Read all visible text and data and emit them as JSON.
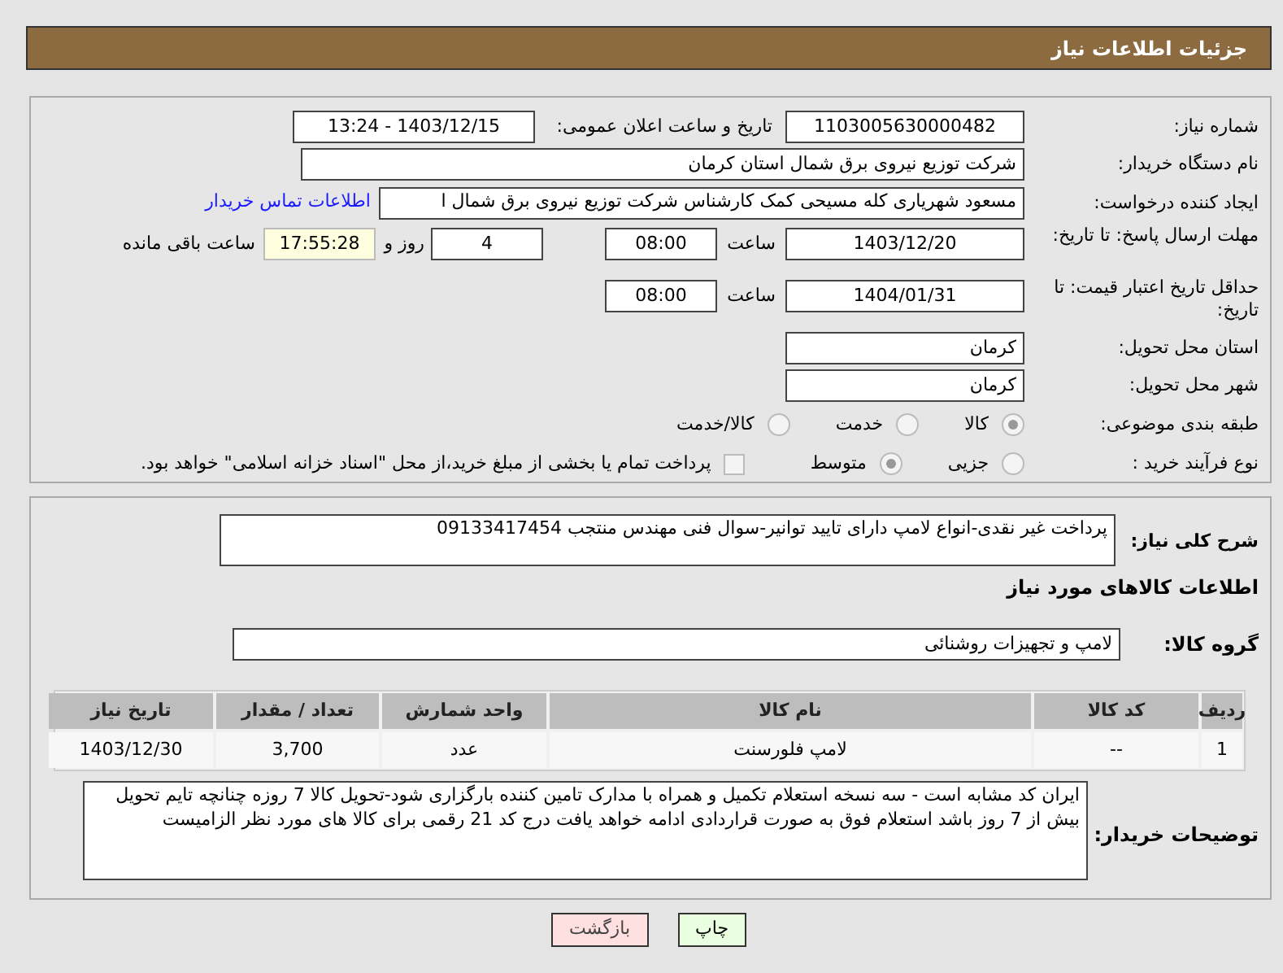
{
  "page_title": "جزئیات اطلاعات نیاز",
  "need_number": {
    "label": "شماره نیاز:",
    "value": "1103005630000482"
  },
  "announce": {
    "label": "تاریخ و ساعت اعلان عمومی:",
    "value": "1403/12/15 - 13:24"
  },
  "buyer_org": {
    "label": "نام دستگاه خریدار:",
    "value": "شرکت توزیع نیروی برق شمال استان کرمان"
  },
  "requester": {
    "label": "ایجاد کننده درخواست:",
    "value": "مسعود شهرياری کله مسیحی کمک کارشناس شرکت توزیع نیروی برق شمال ا",
    "link": "اطلاعات تماس خریدار"
  },
  "response_deadline": {
    "label": "مهلت ارسال پاسخ: تا تاریخ:",
    "date": "1403/12/20",
    "time_label": "ساعت",
    "time": "08:00",
    "days": "4",
    "days_label": "روز و",
    "remaining": "17:55:28",
    "remaining_label": "ساعت باقی مانده"
  },
  "price_validity": {
    "label": "حداقل تاریخ اعتبار قیمت: تا تاریخ:",
    "date": "1404/01/31",
    "time_label": "ساعت",
    "time": "08:00"
  },
  "province": {
    "label": "استان محل تحویل:",
    "value": "کرمان"
  },
  "city": {
    "label": "شهر محل تحویل:",
    "value": "کرمان"
  },
  "category": {
    "label": "طبقه بندی موضوعی:",
    "options": [
      {
        "label": "کالا",
        "selected": true
      },
      {
        "label": "خدمت",
        "selected": false
      },
      {
        "label": "کالا/خدمت",
        "selected": false
      }
    ]
  },
  "process": {
    "label": "نوع فرآیند خرید :",
    "options": [
      {
        "label": "جزیی",
        "selected": false
      },
      {
        "label": "متوسط",
        "selected": true
      }
    ],
    "payment": {
      "label": "پرداخت تمام یا بخشی از مبلغ خرید،از محل \"اسناد خزانه اسلامی\" خواهد بود.",
      "checked": false
    }
  },
  "description": {
    "label": "شرح کلی نیاز:",
    "value": "پرداخت غیر نقدی-انواع لامپ دارای تایید توانیر-سوال فنی مهندس منتجب 09133417454"
  },
  "goods_title": "اطلاعات کالاهای مورد نیاز",
  "goods_group": {
    "label": "گروه کالا:",
    "value": "لامپ و تجهیزات روشنائی"
  },
  "table": {
    "columns": [
      "ردیف",
      "کد کالا",
      "نام کالا",
      "واحد شمارش",
      "تعداد / مقدار",
      "تاریخ نیاز"
    ],
    "rows": [
      [
        "1",
        "--",
        "لامپ فلورسنت",
        "عدد",
        "3,700",
        "1403/12/30"
      ]
    ]
  },
  "buyer_notes": {
    "label": "توضیحات خریدار:",
    "value": "ایران کد مشابه است - سه نسخه استعلام تکمیل و همراه با مدارک تامین کننده بارگزاری شود-تحویل کالا 7 روزه چنانچه تایم تحویل بیش از 7 روز باشد استعلام فوق به صورت قراردادی ادامه خواهد یافت  درج کد 21 رقمی برای کالا های مورد نظر الزامیست"
  },
  "buttons": [
    {
      "label": "چاپ",
      "kind": "print"
    },
    {
      "label": "بازگشت",
      "kind": "back"
    }
  ]
}
